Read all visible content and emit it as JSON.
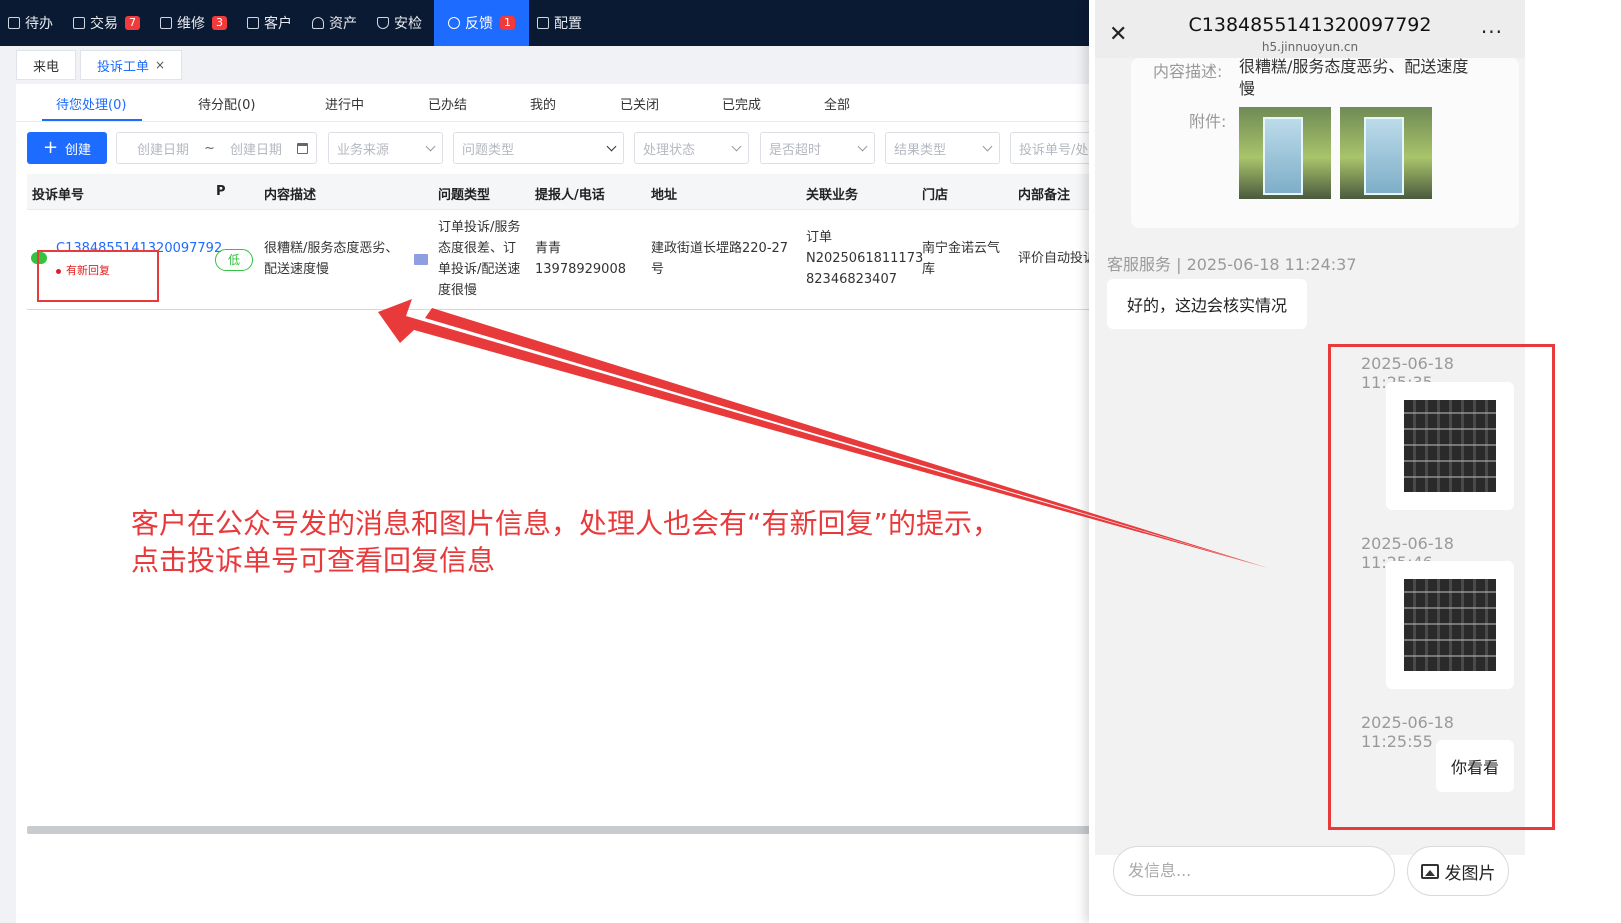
{
  "nav": {
    "items": [
      {
        "label": "待办",
        "badge": ""
      },
      {
        "label": "交易",
        "badge": "7"
      },
      {
        "label": "维修",
        "badge": "3"
      },
      {
        "label": "客户",
        "badge": ""
      },
      {
        "label": "资产",
        "badge": ""
      },
      {
        "label": "安检",
        "badge": ""
      },
      {
        "label": "反馈",
        "badge": "1"
      },
      {
        "label": "配置",
        "badge": ""
      }
    ],
    "active": "反馈"
  },
  "page_tabs": {
    "tab1": "来电",
    "tab2": "投诉工单",
    "close_glyph": "×"
  },
  "subtabs": [
    "待您处理(0)",
    "待分配(0)",
    "进行中",
    "已办结",
    "我的",
    "已关闭",
    "已完成",
    "全部"
  ],
  "filters": {
    "create_label": "创建",
    "date_start": "创建日期",
    "date_sep": "~",
    "date_end": "创建日期",
    "source": "业务来源",
    "problem_type": "问题类型",
    "status": "处理状态",
    "overdue": "是否超时",
    "result_type": "结果类型",
    "search": "投诉单号/处"
  },
  "table": {
    "headers": [
      "投诉单号",
      "P",
      "内容描述",
      "问题类型",
      "提报人/电话",
      "地址",
      "关联业务",
      "门店",
      "内部备注"
    ],
    "row": {
      "ticket_no": "C1384855141320097792",
      "new_reply": "有新回复",
      "priority": "低",
      "description_l1": "很糟糕/服务态度恶劣、",
      "description_l2": "配送速度慢",
      "problem_l1": "订单投诉/服务",
      "problem_l2": "态度很差、订",
      "problem_l3": "单投诉/配送速",
      "problem_l4": "度很慢",
      "reporter": "青青",
      "phone": "13978929008",
      "address_l1": "建政街道长堽路220-27",
      "address_l2": "号",
      "biz_l1": "订单",
      "biz_l2": "N2025061811173",
      "biz_l3": "82346823407",
      "store_l1": "南宁金诺云气",
      "store_l2": "库",
      "remark": "评价自动投诉"
    }
  },
  "annotation": {
    "line1": "客户在公众号发的消息和图片信息，处理人也会有“有新回复”的提示，",
    "line2": "点击投诉单号可查看回复信息"
  },
  "chat": {
    "title": "C1384855141320097792",
    "subtitle": "h5.jinnuoyun.cn",
    "more_glyph": "···",
    "close_glyph": "✕",
    "card": {
      "desc_label": "内容描述:",
      "desc_value_l1": "很糟糕/服务态度恶劣、配送速度",
      "desc_value_l2": "慢",
      "attach_label": "附件:"
    },
    "messages": [
      {
        "meta": "客服服务 | 2025-06-18 11:24:37",
        "text": "好的，这边会核实情况"
      },
      {
        "meta": "2025-06-18 11:25:35",
        "text": ""
      },
      {
        "meta": "2025-06-18 11:25:46",
        "text": ""
      },
      {
        "meta": "2025-06-18 11:25:55",
        "text": "你看看"
      }
    ],
    "input_placeholder": "发信息...",
    "send_image_label": "发图片"
  },
  "colors": {
    "nav_bg": "#0b1a33",
    "accent": "#1e6bff",
    "annotation_red": "#e8393b",
    "priority_green": "#34c241"
  }
}
